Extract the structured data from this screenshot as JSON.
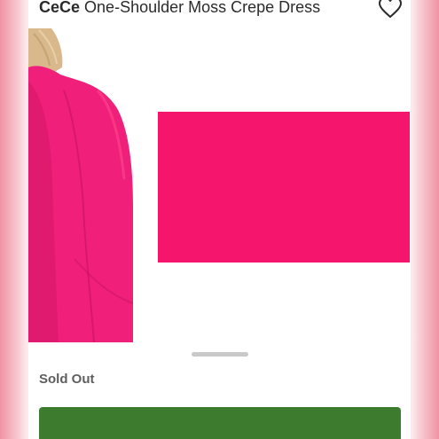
{
  "product": {
    "brand": "CeCe",
    "name": "One-Shoulder Moss Crepe Dress",
    "swatch_color": "#f5156c",
    "status": "Sold Out"
  },
  "icons": {
    "favorite": "heart-outline-icon"
  },
  "colors": {
    "dress_pink": "#f0207a",
    "cta_green": "#3d7b2e",
    "status_gray": "#5e5e5e"
  }
}
